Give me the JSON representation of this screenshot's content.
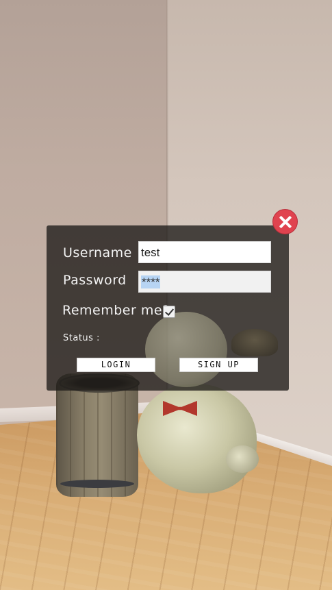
{
  "scene": {
    "background_objects": [
      "barrel",
      "snowman",
      "bow-tie",
      "hat"
    ]
  },
  "login_dialog": {
    "close_icon": "close-icon",
    "username_label": "Username",
    "username_value": "test",
    "password_label": "Password",
    "password_value": "****",
    "remember_label": "Remember me?",
    "remember_checked": true,
    "status_label": "Status :",
    "status_value": "",
    "login_button": "LOGIN",
    "signup_button": "SIGN UP"
  },
  "colors": {
    "dialog_bg": "#1e1b18",
    "close_button": "#e0434f",
    "button_bg": "#ffffff",
    "label_text": "#f2f2f2"
  }
}
